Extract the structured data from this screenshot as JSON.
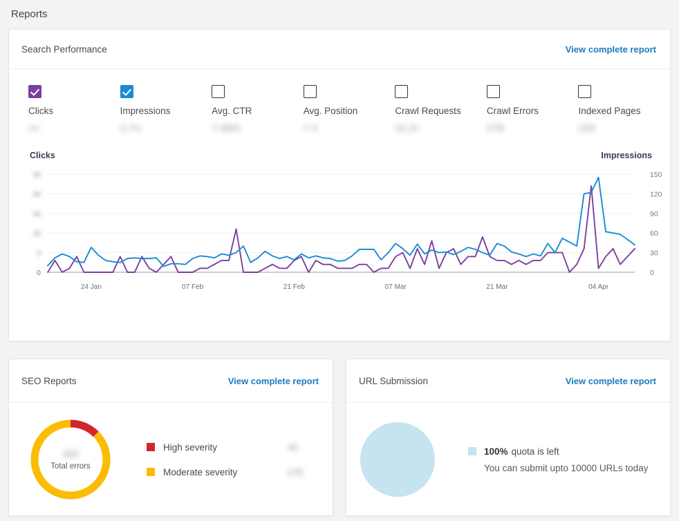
{
  "page": {
    "title": "Reports"
  },
  "colors": {
    "clicks_purple": "#7b3f9e",
    "impressions_blue": "#1a8ad4",
    "link_blue": "#1c7cc0",
    "high_severity_red": "#d2262f",
    "moderate_severity_yellow": "#fbbc05",
    "quota_light_blue": "#c5e4ef",
    "page_bg": "#f3f3f3",
    "card_bg": "#ffffff"
  },
  "search_performance": {
    "title": "Search Performance",
    "view_report_label": "View complete report",
    "metrics": [
      {
        "label": "Clicks",
        "value": "•••",
        "checked": true,
        "check_color": "purple"
      },
      {
        "label": "Impressions",
        "value": "2,7••",
        "checked": true,
        "check_color": "blue"
      },
      {
        "label": "Avg. CTR",
        "value": "7.46%",
        "checked": false,
        "check_color": ""
      },
      {
        "label": "Avg. Position",
        "value": "7.3",
        "checked": false,
        "check_color": ""
      },
      {
        "label": "Crawl Requests",
        "value": "10,2•",
        "checked": false,
        "check_color": ""
      },
      {
        "label": "Crawl Errors",
        "value": "278",
        "checked": false,
        "check_color": ""
      },
      {
        "label": "Indexed Pages",
        "value": "223",
        "checked": false,
        "check_color": ""
      }
    ]
  },
  "chart_data": {
    "type": "line",
    "title": "Search Performance",
    "left_axis_title": "Clicks",
    "right_axis_title": "Impressions",
    "xlabel": "",
    "grid": true,
    "legend_position": "top-checkboxes",
    "left_axis": {
      "label": "Clicks",
      "ticks": [
        "0",
        "5",
        "10",
        "15",
        "20",
        "25"
      ],
      "tick_values": [
        0,
        5,
        10,
        15,
        20,
        25
      ],
      "ylim": [
        0,
        25
      ],
      "blurred": true
    },
    "right_axis": {
      "label": "Impressions",
      "ticks": [
        "0",
        "30",
        "60",
        "90",
        "120",
        "150"
      ],
      "tick_values": [
        0,
        30,
        60,
        90,
        120,
        150
      ],
      "ylim": [
        0,
        150
      ],
      "blurred": false
    },
    "x_tick_labels": [
      "24 Jan",
      "07 Feb",
      "21 Feb",
      "07 Mar",
      "21 Mar",
      "04 Apr"
    ],
    "x_tick_indices": [
      6,
      20,
      34,
      48,
      62,
      76
    ],
    "series": [
      {
        "name": "Clicks",
        "color": "#7b3f9e",
        "axis": "left",
        "values": [
          0,
          3,
          0,
          1,
          4,
          0,
          0,
          0,
          0,
          0,
          4,
          0,
          0,
          4,
          1,
          0,
          2,
          4,
          0,
          0,
          0,
          1,
          1,
          2,
          3,
          3,
          11,
          0,
          0,
          0,
          1,
          2,
          1,
          1,
          3,
          4,
          0,
          3,
          2,
          2,
          1,
          1,
          1,
          2,
          2,
          0,
          1,
          1,
          4,
          5,
          1,
          6,
          2,
          8,
          1,
          5,
          6,
          2,
          4,
          4,
          9,
          4,
          3,
          3,
          2,
          3,
          2,
          3,
          3,
          5,
          5,
          5,
          0,
          2,
          6,
          22,
          1,
          4,
          6,
          2,
          4,
          6
        ]
      },
      {
        "name": "Impressions",
        "color": "#1a8ad4",
        "axis": "right",
        "values": [
          10,
          22,
          28,
          24,
          16,
          15,
          38,
          26,
          18,
          16,
          15,
          21,
          22,
          21,
          21,
          22,
          9,
          13,
          13,
          12,
          21,
          25,
          24,
          22,
          28,
          26,
          30,
          40,
          15,
          22,
          32,
          25,
          21,
          24,
          19,
          28,
          22,
          25,
          22,
          21,
          17,
          18,
          25,
          35,
          35,
          35,
          19,
          30,
          44,
          36,
          26,
          43,
          28,
          34,
          30,
          31,
          27,
          32,
          38,
          35,
          30,
          26,
          44,
          40,
          31,
          28,
          24,
          28,
          25,
          44,
          30,
          52,
          46,
          40,
          120,
          122,
          145,
          62,
          60,
          58,
          50,
          42
        ]
      }
    ]
  },
  "seo_reports": {
    "title": "SEO Reports",
    "view_report_label": "View complete report",
    "donut_label": "Total errors",
    "donut_total": "320",
    "donut": {
      "type": "pie",
      "segments": [
        {
          "name": "Moderate severity",
          "color": "#fbbc05",
          "percent": 87.5
        },
        {
          "name": "High severity",
          "color": "#d2262f",
          "percent": 12.5
        }
      ]
    },
    "legend": [
      {
        "label": "High severity",
        "value": "40",
        "color": "#d2262f"
      },
      {
        "label": "Moderate severity",
        "value": "278",
        "color": "#fbbc05"
      }
    ]
  },
  "url_submission": {
    "title": "URL Submission",
    "view_report_label": "View complete report",
    "quota_percent": "100%",
    "quota_suffix": "quota is left",
    "quota_detail": "You can submit upto 10000 URLs today"
  }
}
